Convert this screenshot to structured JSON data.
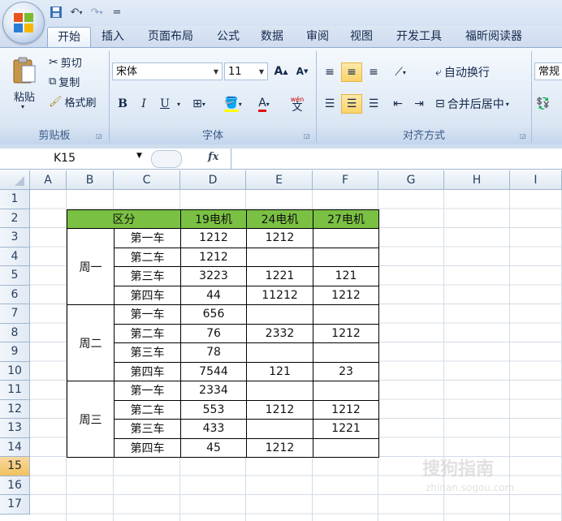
{
  "quick_access": {
    "separator_glyph": "="
  },
  "tabs": [
    "开始",
    "插入",
    "页面布局",
    "公式",
    "数据",
    "审阅",
    "视图",
    "开发工具",
    "福昕阅读器"
  ],
  "clipboard": {
    "paste": "粘贴",
    "cut": "剪切",
    "copy": "复制",
    "format_painter": "格式刷",
    "label": "剪贴板"
  },
  "font": {
    "name": "宋体",
    "size": "11",
    "grow": "A",
    "shrink": "A",
    "bold": "B",
    "italic": "I",
    "underline": "U",
    "font_color_glyph": "A",
    "phonetic": "wén",
    "phonetic_char": "文",
    "label": "字体"
  },
  "alignment": {
    "wrap_text": "自动换行",
    "merge_center": "合并后居中",
    "label": "对齐方式"
  },
  "number": {
    "format": "常规"
  },
  "formula_bar": {
    "name_box": "K15",
    "fx": "fx"
  },
  "columns": [
    "A",
    "B",
    "C",
    "D",
    "E",
    "F",
    "G",
    "H",
    "I"
  ],
  "rows": [
    "1",
    "2",
    "3",
    "4",
    "5",
    "6",
    "7",
    "8",
    "9",
    "10",
    "11",
    "12",
    "13",
    "14",
    "15",
    "16",
    "17"
  ],
  "selected_row": "15",
  "table": {
    "header": {
      "section": "区分",
      "col_d": "19电机",
      "col_e": "24电机",
      "col_f": "27电机"
    },
    "groups": [
      {
        "label": "周一",
        "rows": [
          {
            "car": "第一车",
            "d": "1212",
            "e": "1212",
            "f": ""
          },
          {
            "car": "第二车",
            "d": "1212",
            "e": "",
            "f": ""
          },
          {
            "car": "第三车",
            "d": "3223",
            "e": "1221",
            "f": "121"
          },
          {
            "car": "第四车",
            "d": "44",
            "e": "11212",
            "f": "1212"
          }
        ]
      },
      {
        "label": "周二",
        "rows": [
          {
            "car": "第一车",
            "d": "656",
            "e": "",
            "f": ""
          },
          {
            "car": "第二车",
            "d": "76",
            "e": "2332",
            "f": "1212"
          },
          {
            "car": "第三车",
            "d": "78",
            "e": "",
            "f": ""
          },
          {
            "car": "第四车",
            "d": "7544",
            "e": "121",
            "f": "23"
          }
        ]
      },
      {
        "label": "周三",
        "rows": [
          {
            "car": "第一车",
            "d": "2334",
            "e": "",
            "f": ""
          },
          {
            "car": "第二车",
            "d": "553",
            "e": "1212",
            "f": "1212"
          },
          {
            "car": "第三车",
            "d": "433",
            "e": "",
            "f": "1221"
          },
          {
            "car": "第四车",
            "d": "45",
            "e": "1212",
            "f": ""
          }
        ]
      }
    ]
  },
  "watermark": {
    "text": "搜狗指南",
    "sub": "zhinan.sogou.com"
  },
  "colors": {
    "header_fill": "#7ac143",
    "selected_row": "#f5c96b",
    "ribbon": "#dbe7f6"
  }
}
